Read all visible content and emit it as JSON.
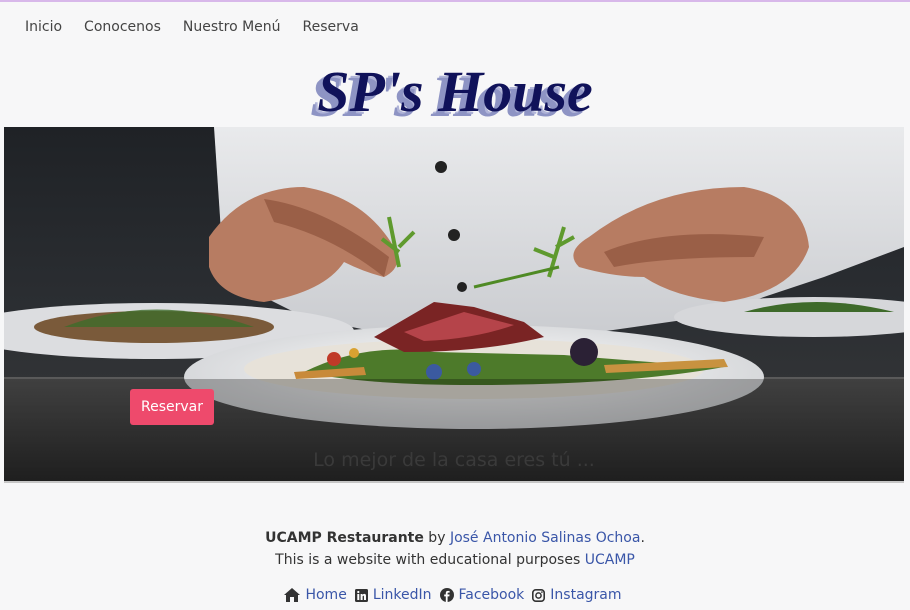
{
  "nav": {
    "items": [
      "Inicio",
      "Conocenos",
      "Nuestro Menú",
      "Reserva"
    ]
  },
  "logo": {
    "text": "SP's House"
  },
  "hero": {
    "button_label": "Reservar",
    "tagline": "Lo mejor de la casa eres tú ..."
  },
  "footer": {
    "brand": "UCAMP Restaurante",
    "by": " by ",
    "author": "José Antonio Salinas Ochoa",
    "period": ".",
    "purpose_text": "This is a website with educational purposes ",
    "purpose_link": "UCAMP",
    "social": [
      {
        "icon": "home-icon",
        "label": "Home"
      },
      {
        "icon": "linkedin-icon",
        "label": "LinkedIn"
      },
      {
        "icon": "facebook-icon",
        "label": "Facebook"
      },
      {
        "icon": "instagram-icon",
        "label": "Instagram"
      }
    ]
  },
  "colors": {
    "accent": "#ee4a6c",
    "logo": "#10125a",
    "link": "#3a56a8"
  }
}
